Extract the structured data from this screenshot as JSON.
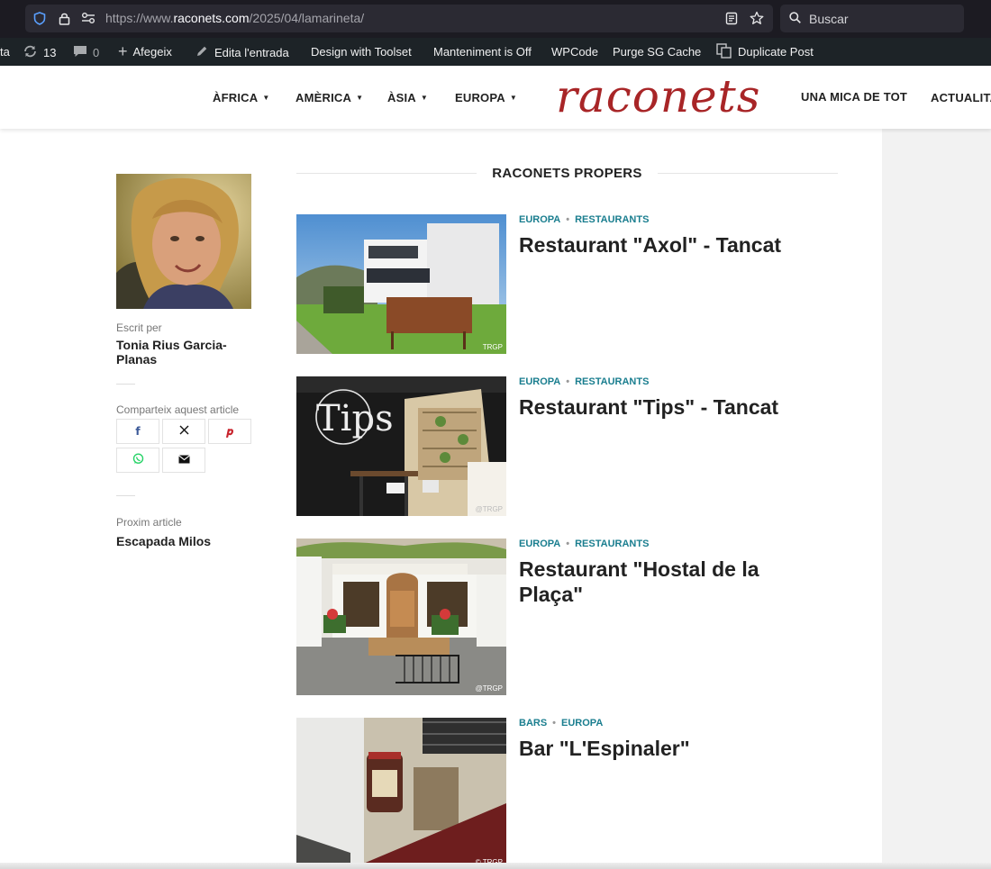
{
  "browser": {
    "url_prefix": "https://www.",
    "url_domain": "raconets.com",
    "url_path": "/2025/04/lamarineta/",
    "search_placeholder": "Buscar"
  },
  "admin_bar": {
    "cut_label": "ta",
    "updates_count": "13",
    "comments_count": "0",
    "add_label": "Afegeix",
    "edit_label": "Edita l'entrada",
    "toolset_label": "Design with Toolset",
    "maintenance_label": "Manteniment is Off",
    "wpcode_label": "WPCode",
    "purge_label": "Purge SG Cache",
    "duplicate_label": "Duplicate Post"
  },
  "nav": {
    "items": [
      "ÀFRICA",
      "AMÈRICA",
      "ÀSIA",
      "EUROPA"
    ],
    "logo": "raconets",
    "right_items": [
      "UNA MICA DE TOT",
      "ACTUALITA"
    ]
  },
  "sidebar": {
    "written_by_label": "Escrit per",
    "author_line1": "Tonia Rius Garcia-",
    "author_line2": "Planas",
    "share_label": "Comparteix aquest article",
    "share_buttons": [
      "facebook-icon",
      "x-icon",
      "pinterest-icon",
      "whatsapp-icon",
      "email-icon"
    ],
    "next_label": "Proxim article",
    "next_title": "Escapada Milos"
  },
  "main": {
    "section_title": "RACONETS PROPERS",
    "posts": [
      {
        "cat1": "EUROPA",
        "cat2": "RESTAURANTS",
        "title": "Restaurant \"Axol\" - Tancat",
        "watermark": "TRGP"
      },
      {
        "cat1": "EUROPA",
        "cat2": "RESTAURANTS",
        "title": "Restaurant \"Tips\" - Tancat",
        "sign": "Tips",
        "watermark": "@TRGP"
      },
      {
        "cat1": "EUROPA",
        "cat2": "RESTAURANTS",
        "title": "Restaurant \"Hostal de la Plaça\"",
        "watermark": "@TRGP"
      },
      {
        "cat1": "BARS",
        "cat2": "EUROPA",
        "title": "Bar \"L'Espinaler\"",
        "watermark": "© TRGP"
      }
    ]
  },
  "colors": {
    "accent_teal": "#1a7e8f",
    "logo_red": "#a82527",
    "admin_bg": "#1d2327"
  }
}
